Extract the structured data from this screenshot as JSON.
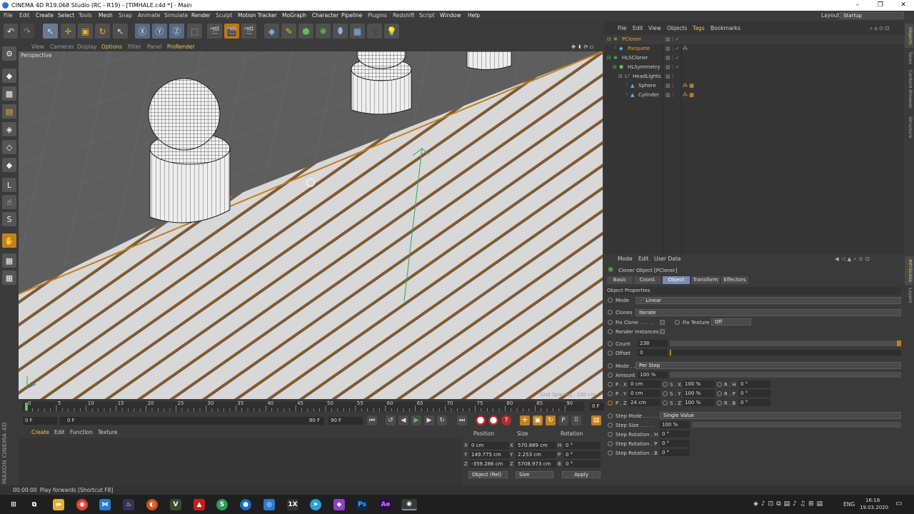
{
  "window": {
    "title": "CINEMA 4D R19.068 Studio (RC - R19) - [TIMHALE.c4d *] - Main",
    "min": "–",
    "max": "❐",
    "close": "✕"
  },
  "menu": [
    "File",
    "Edit",
    "Create",
    "Select",
    "Tools",
    "Mesh",
    "Snap",
    "Animate",
    "Simulate",
    "Render",
    "Sculpt",
    "Motion Tracker",
    "MoGraph",
    "Character",
    "Pipeline",
    "Plugins",
    "Redshift",
    "Script",
    "Window",
    "Help"
  ],
  "layout": {
    "label": "Layout:",
    "value": "Startup"
  },
  "viewport": {
    "menu": [
      "View",
      "Cameras",
      "Display",
      "Options",
      "Filter",
      "Panel",
      "ProRender"
    ],
    "label": "Perspective",
    "grid_spacing": "Grid Spacing : 100 cm"
  },
  "timeline": {
    "ticks": [
      "0",
      "5",
      "10",
      "15",
      "20",
      "25",
      "30",
      "35",
      "40",
      "45",
      "50",
      "55",
      "60",
      "65",
      "70",
      "75",
      "80",
      "85",
      "90"
    ],
    "current": "0 F"
  },
  "transport": {
    "start": "0 F",
    "preview_start": "0 F",
    "preview_end": "90 F",
    "end": "90 F"
  },
  "material": {
    "menu": [
      "Create",
      "Edit",
      "Function",
      "Texture"
    ],
    "logo": "MAXON CINEMA 4D"
  },
  "coords": {
    "headers": [
      "Position",
      "Size",
      "Rotation"
    ],
    "rows": [
      {
        "axis": "X",
        "pos": "0 cm",
        "saxis": "X",
        "size": "570.889 cm",
        "raxis": "H",
        "rot": "0 °"
      },
      {
        "axis": "Y",
        "pos": "149.775 cm",
        "saxis": "Y",
        "size": "2.253 cm",
        "raxis": "P",
        "rot": "0 °"
      },
      {
        "axis": "Z",
        "pos": "-359.286 cm",
        "saxis": "Z",
        "size": "5708.973 cm",
        "raxis": "B",
        "rot": "0 °"
      }
    ],
    "mode": "Object (Rel)",
    "size_mode": "Size",
    "apply": "Apply"
  },
  "status": {
    "time": "00:00:00",
    "text": "Play forwards [Shortcut F8]"
  },
  "objects": {
    "menu": [
      "File",
      "Edit",
      "View",
      "Objects",
      "Tags",
      "Bookmarks"
    ],
    "items": [
      {
        "name": "PCloner",
        "indent": 0,
        "color": "#f0a030"
      },
      {
        "name": "Parquete",
        "indent": 1,
        "color": "#f0a030"
      },
      {
        "name": "HLSCloner",
        "indent": 0,
        "color": "#cfcfcf"
      },
      {
        "name": "HLSymmetry",
        "indent": 1,
        "color": "#cfcfcf"
      },
      {
        "name": "HeadLights",
        "indent": 2,
        "color": "#cfcfcf"
      },
      {
        "name": "Sphere",
        "indent": 3,
        "color": "#cfcfcf"
      },
      {
        "name": "Cylinder",
        "indent": 3,
        "color": "#cfcfcf"
      }
    ]
  },
  "right_tabs": [
    "Objects",
    "Takes",
    "Content Browser",
    "Structure",
    "Attributes",
    "Layers"
  ],
  "attributes": {
    "menu": [
      "Mode",
      "Edit",
      "User Data"
    ],
    "object_title": "Cloner Object [PCloner]",
    "tabs": [
      "Basic",
      "Coord.",
      "Object",
      "Transform",
      "Effectors"
    ],
    "section": "Object Properties",
    "mode_label": "Mode",
    "mode_value": "Linear",
    "clones_label": "Clones",
    "clones_value": "Iterate",
    "fix_clone": "Fix Clone . . . . .",
    "fix_texture": "Fix Texture",
    "fix_texture_value": "Off",
    "render_instances": "Render Instances",
    "count_label": "Count",
    "count_value": "238",
    "offset_label": "Offset",
    "offset_value": "0",
    "mode2_label": "Mode . . . .",
    "mode2_value": "Per Step",
    "amount_label": "Amount",
    "amount_value": "100 %",
    "p_rows": [
      {
        "pl": "P . X",
        "pv": "0 cm",
        "sl": "S . X",
        "sv": "100 %",
        "rl": "R . H",
        "rv": "0 °"
      },
      {
        "pl": "P . Y",
        "pv": "0 cm",
        "sl": "S . Y",
        "sv": "100 %",
        "rl": "R . P",
        "rv": "0 °"
      },
      {
        "pl": "P . Z",
        "pv": "24 cm",
        "sl": "S . Z",
        "sv": "100 %",
        "rl": "R . B",
        "rv": "0 °"
      }
    ],
    "step_mode_label": "Step Mode . . . . .",
    "step_mode_value": "Single Value",
    "step_size_label": "Step Size . . . . .",
    "step_size_value": "100 %",
    "step_rot_h_label": "Step Rotation . H",
    "step_rot_h_value": "0 °",
    "step_rot_p_label": "Step Rotation . P",
    "step_rot_p_value": "0 °",
    "step_rot_b_label": "Step Rotation . B",
    "step_rot_b_value": "0 °"
  },
  "taskbar": {
    "lang": "ENG",
    "time": "16:18",
    "date": "19.03.2020"
  }
}
